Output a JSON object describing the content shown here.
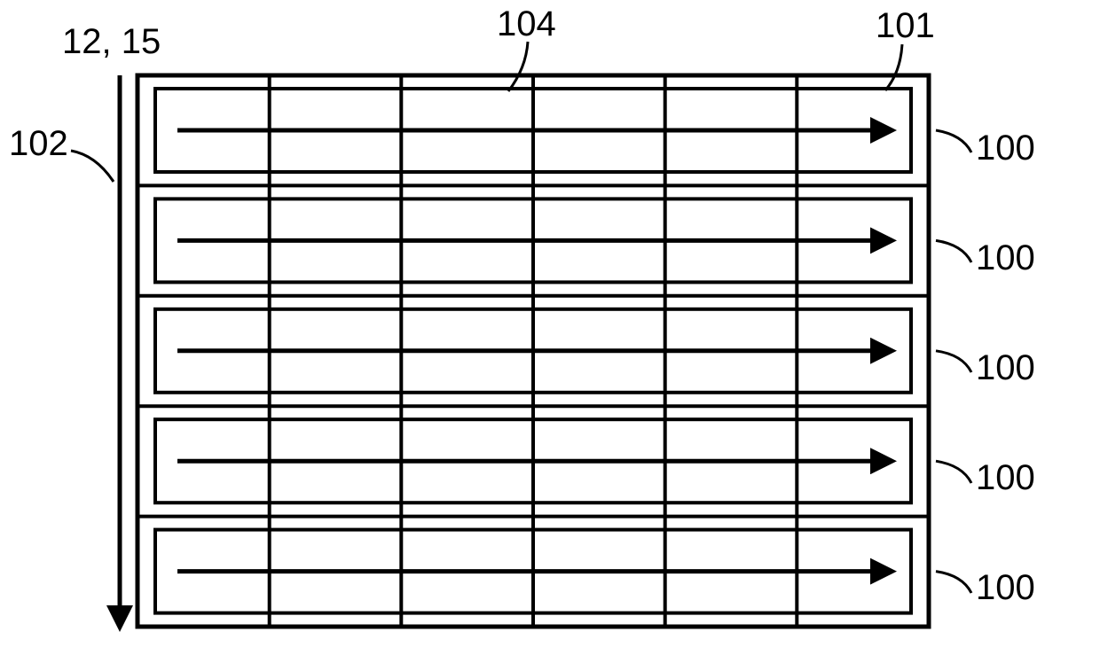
{
  "labels": {
    "topLeft": "12, 15",
    "leader104": "104",
    "leader101": "101",
    "leftSide": "102",
    "rowLabel": "100"
  },
  "grid": {
    "rows": 5,
    "cols": 6
  },
  "strokeColor": "#000000",
  "strokeWidth": 4
}
